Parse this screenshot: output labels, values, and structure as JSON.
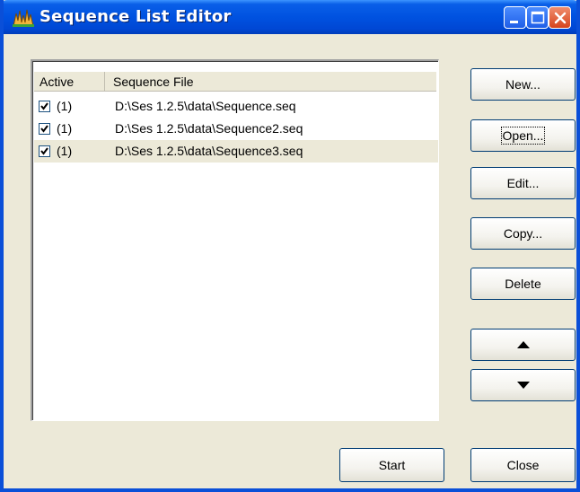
{
  "window": {
    "title": "Sequence List Editor"
  },
  "list": {
    "columns": [
      "Active",
      "Sequence File"
    ],
    "rows": [
      {
        "active": true,
        "level": "(1)",
        "file": "D:\\Ses 1.2.5\\data\\Sequence.seq"
      },
      {
        "active": true,
        "level": "(1)",
        "file": "D:\\Ses 1.2.5\\data\\Sequence2.seq"
      },
      {
        "active": true,
        "level": "(1)",
        "file": "D:\\Ses 1.2.5\\data\\Sequence3.seq",
        "selected": true
      }
    ]
  },
  "buttons": {
    "new": "New...",
    "open": "Open...",
    "edit": "Edit...",
    "copy": "Copy...",
    "delete": "Delete",
    "start": "Start",
    "close": "Close"
  },
  "icons": {
    "app": "sequence-app-icon",
    "minimize": "minimize-icon",
    "maximize": "maximize-icon",
    "close": "close-icon",
    "move_up": "arrow-up-icon",
    "move_down": "arrow-down-icon",
    "check": "checkmark-icon"
  },
  "colors": {
    "titlebar": "#0052e0",
    "close_button": "#d6441d",
    "dialog_bg": "#ece9d8"
  }
}
